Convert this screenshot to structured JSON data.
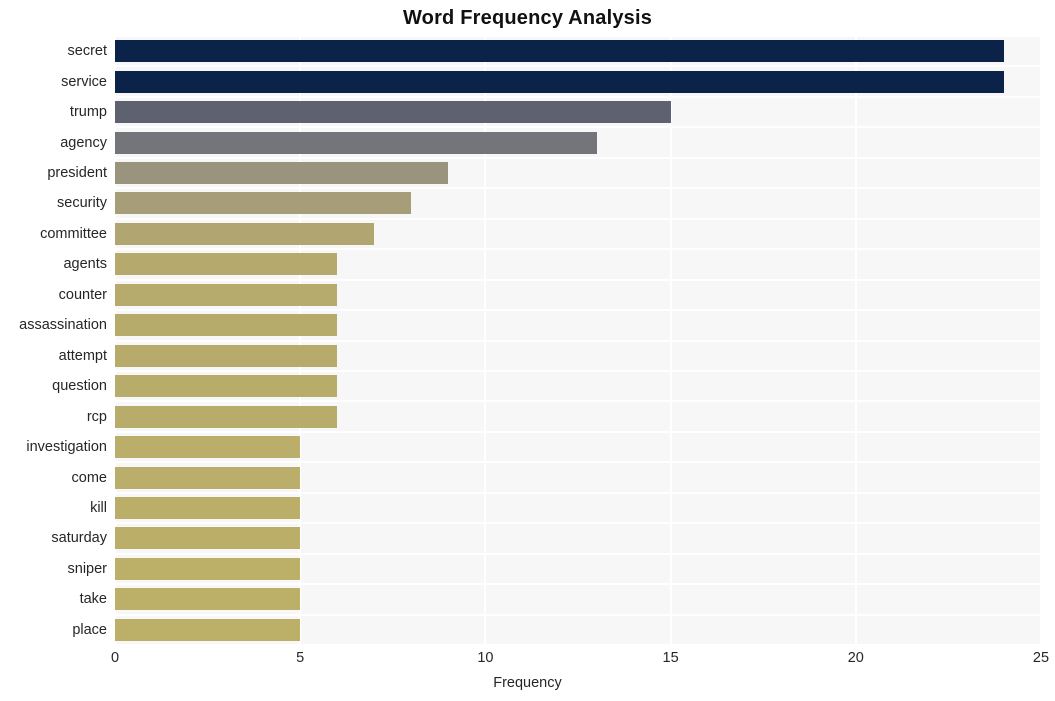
{
  "chart_data": {
    "type": "bar",
    "orientation": "horizontal",
    "title": "Word Frequency Analysis",
    "xlabel": "Frequency",
    "ylabel": "",
    "categories": [
      "secret",
      "service",
      "trump",
      "agency",
      "president",
      "security",
      "committee",
      "agents",
      "counter",
      "assassination",
      "attempt",
      "question",
      "rcp",
      "investigation",
      "come",
      "kill",
      "saturday",
      "sniper",
      "take",
      "place"
    ],
    "values": [
      24,
      24,
      15,
      13,
      9,
      8,
      7,
      6,
      6,
      6,
      6,
      6,
      6,
      5,
      5,
      5,
      5,
      5,
      5,
      5
    ],
    "bar_colors": [
      "#0b2349",
      "#0b2349",
      "#5e6270",
      "#74757b",
      "#9a937d",
      "#a79d79",
      "#b1a571",
      "#b5a96e",
      "#b6aa6d",
      "#b7ab6c",
      "#b7ab6c",
      "#b8ac6b",
      "#b8ac6b",
      "#baae6a",
      "#baae6a",
      "#bbae69",
      "#bbae69",
      "#bcaf68",
      "#bcaf68",
      "#bcaf68"
    ],
    "xlim": [
      0,
      25
    ],
    "xticks": [
      0,
      5,
      10,
      15,
      20,
      25
    ],
    "xticklabels": [
      "0",
      "5",
      "10",
      "15",
      "20",
      "25"
    ],
    "grid": true,
    "grid_color": "#ffffff",
    "plot_background": "#f7f7f7",
    "figure_background": "#ffffff",
    "legend": "none",
    "title_color": "#111111",
    "tick_label_color": "#262626"
  }
}
